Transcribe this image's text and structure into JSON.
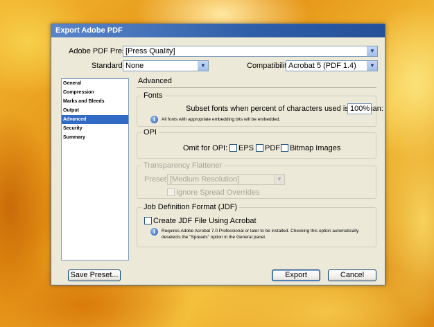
{
  "window": {
    "title": "Export Adobe PDF"
  },
  "preset": {
    "label": "Adobe PDF Preset:",
    "value": "[Press Quality]"
  },
  "standard": {
    "label": "Standard:",
    "value": "None"
  },
  "compatibility": {
    "label": "Compatibility:",
    "value": "Acrobat 5 (PDF 1.4)"
  },
  "sidebar": {
    "items": [
      {
        "label": "General"
      },
      {
        "label": "Compression"
      },
      {
        "label": "Marks and Bleeds"
      },
      {
        "label": "Output"
      },
      {
        "label": "Advanced",
        "selected": true
      },
      {
        "label": "Security"
      },
      {
        "label": "Summary"
      }
    ]
  },
  "panel": {
    "title": "Advanced"
  },
  "fonts": {
    "title": "Fonts",
    "subset_label": "Subset fonts when percent of characters used is less than:",
    "subset_value": "100%",
    "info": "All fonts with appropriate embedding bits will be embedded."
  },
  "opi": {
    "title": "OPI",
    "omit_label": "Omit for OPI:",
    "eps": "EPS",
    "pdf": "PDF",
    "bitmap": "Bitmap Images"
  },
  "transparency": {
    "title": "Transparency Flattener",
    "preset_label": "Preset:",
    "preset_value": "[Medium Resolution]",
    "ignore_overrides": "Ignore Spread Overrides"
  },
  "jdf": {
    "title": "Job Definition Format (JDF)",
    "create_label": "Create JDF File Using Acrobat",
    "info_line1": "Requires Adobe Acrobat 7.0 Professional or later to be installed. Checking this option automatically",
    "info_line2": "deselects the \"Spreads\" option in the General panel."
  },
  "buttons": {
    "save_preset": "Save Preset...",
    "export": "Export",
    "cancel": "Cancel"
  },
  "colors": {
    "accent": "#316ac5",
    "title_bar": "#2f5ea8",
    "dialog_bg": "#ece9d8"
  }
}
